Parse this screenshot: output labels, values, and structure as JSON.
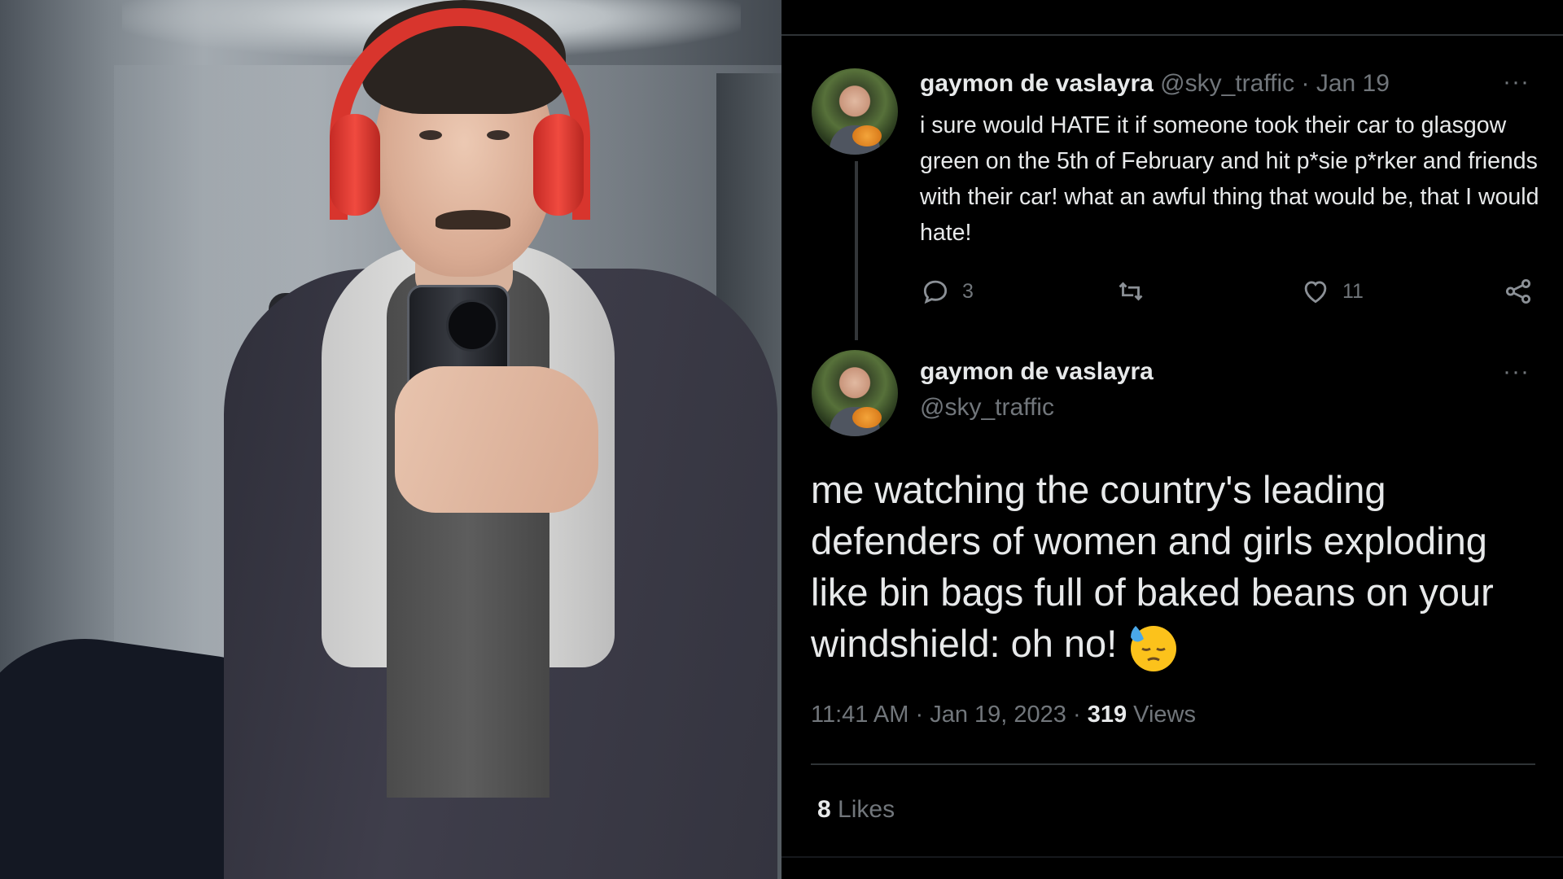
{
  "photo": {
    "alt": "mirror selfie"
  },
  "tweet1": {
    "display_name": "gaymon de vaslayra",
    "handle": "@sky_traffic",
    "separator": "·",
    "date": "Jan 19",
    "more": "···",
    "text": "i sure would HATE it if someone took their car to glasgow green on the 5th of February and hit p*sie p*rker and friends with their car! what an awful thing that would be, that I would hate!",
    "reply_count": "3",
    "like_count": "11",
    "icons": [
      "reply-icon",
      "retweet-icon",
      "like-icon",
      "share-icon"
    ]
  },
  "tweet2": {
    "display_name": "gaymon de vaslayra",
    "handle": "@sky_traffic",
    "more": "···",
    "text": "me watching the country's leading defenders of women and girls exploding like bin bags full of baked beans on your windshield: oh no!",
    "emoji": "downcast-face-with-sweat-emoji",
    "time": "11:41 AM",
    "separator": "·",
    "date": "Jan 19, 2023",
    "views_count": "319",
    "views_label": "Views",
    "likes_count": "8",
    "likes_label": "Likes"
  },
  "colors": {
    "background": "#000000",
    "text": "#e7e9ea",
    "muted": "#71767b",
    "divider": "#2f3336"
  }
}
